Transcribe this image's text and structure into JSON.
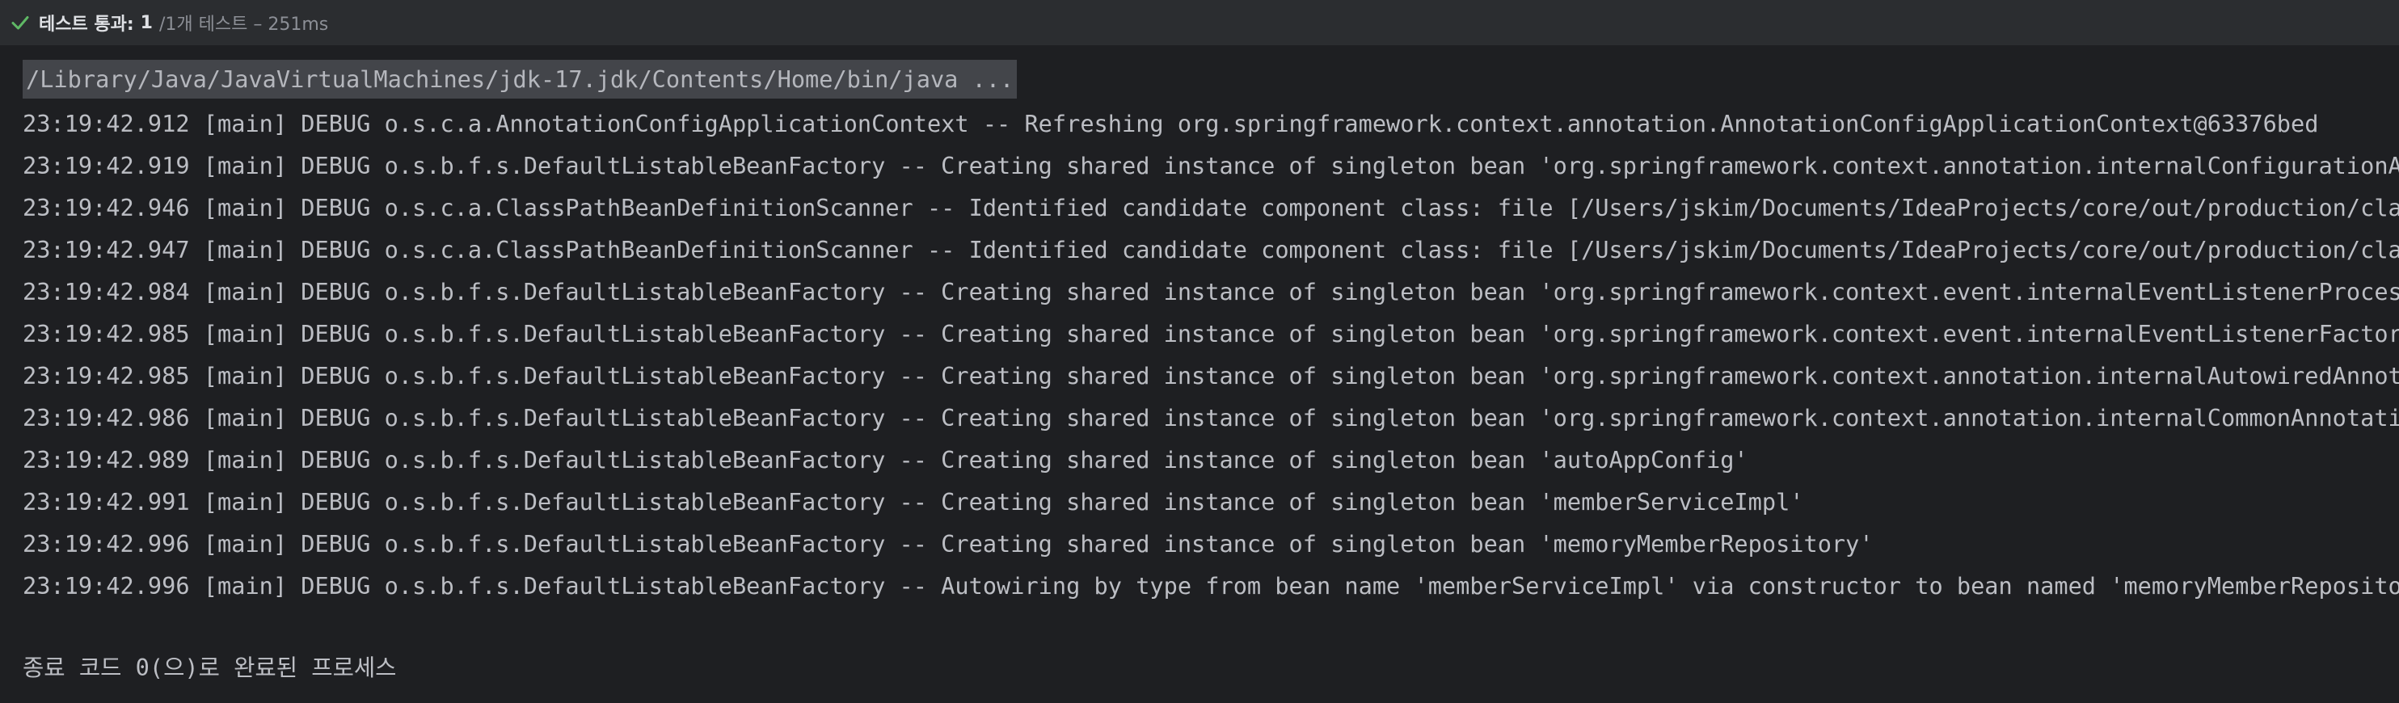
{
  "status": {
    "title": "테스트 통과:",
    "count": "1",
    "detail": "/1개 테스트 – 251ms",
    "icon": "check-icon",
    "icon_color": "#5fb865"
  },
  "console": {
    "command": "/Library/Java/JavaVirtualMachines/jdk-17.jdk/Contents/Home/bin/java ...",
    "lines": [
      "23:19:42.912 [main] DEBUG o.s.c.a.AnnotationConfigApplicationContext -- Refreshing org.springframework.context.annotation.AnnotationConfigApplicationContext@63376bed",
      "23:19:42.919 [main] DEBUG o.s.b.f.s.DefaultListableBeanFactory -- Creating shared instance of singleton bean 'org.springframework.context.annotation.internalConfigurationAnnotationProcessor'",
      "23:19:42.946 [main] DEBUG o.s.c.a.ClassPathBeanDefinitionScanner -- Identified candidate component class: file [/Users/jskim/Documents/IdeaProjects/core/out/production/classes/hello/core/member/MemberServiceImpl.class]",
      "23:19:42.947 [main] DEBUG o.s.c.a.ClassPathBeanDefinitionScanner -- Identified candidate component class: file [/Users/jskim/Documents/IdeaProjects/core/out/production/classes/hello/core/member/MemoryMemberRepository.class]",
      "23:19:42.984 [main] DEBUG o.s.b.f.s.DefaultListableBeanFactory -- Creating shared instance of singleton bean 'org.springframework.context.event.internalEventListenerProcessor'",
      "23:19:42.985 [main] DEBUG o.s.b.f.s.DefaultListableBeanFactory -- Creating shared instance of singleton bean 'org.springframework.context.event.internalEventListenerFactory'",
      "23:19:42.985 [main] DEBUG o.s.b.f.s.DefaultListableBeanFactory -- Creating shared instance of singleton bean 'org.springframework.context.annotation.internalAutowiredAnnotationProcessor'",
      "23:19:42.986 [main] DEBUG o.s.b.f.s.DefaultListableBeanFactory -- Creating shared instance of singleton bean 'org.springframework.context.annotation.internalCommonAnnotationProcessor'",
      "23:19:42.989 [main] DEBUG o.s.b.f.s.DefaultListableBeanFactory -- Creating shared instance of singleton bean 'autoAppConfig'",
      "23:19:42.991 [main] DEBUG o.s.b.f.s.DefaultListableBeanFactory -- Creating shared instance of singleton bean 'memberServiceImpl'",
      "23:19:42.996 [main] DEBUG o.s.b.f.s.DefaultListableBeanFactory -- Creating shared instance of singleton bean 'memoryMemberRepository'",
      "23:19:42.996 [main] DEBUG o.s.b.f.s.DefaultListableBeanFactory -- Autowiring by type from bean name 'memberServiceImpl' via constructor to bean named 'memoryMemberRepository'"
    ],
    "exit_message": "종료 코드 0(으)로 완료된 프로세스"
  }
}
